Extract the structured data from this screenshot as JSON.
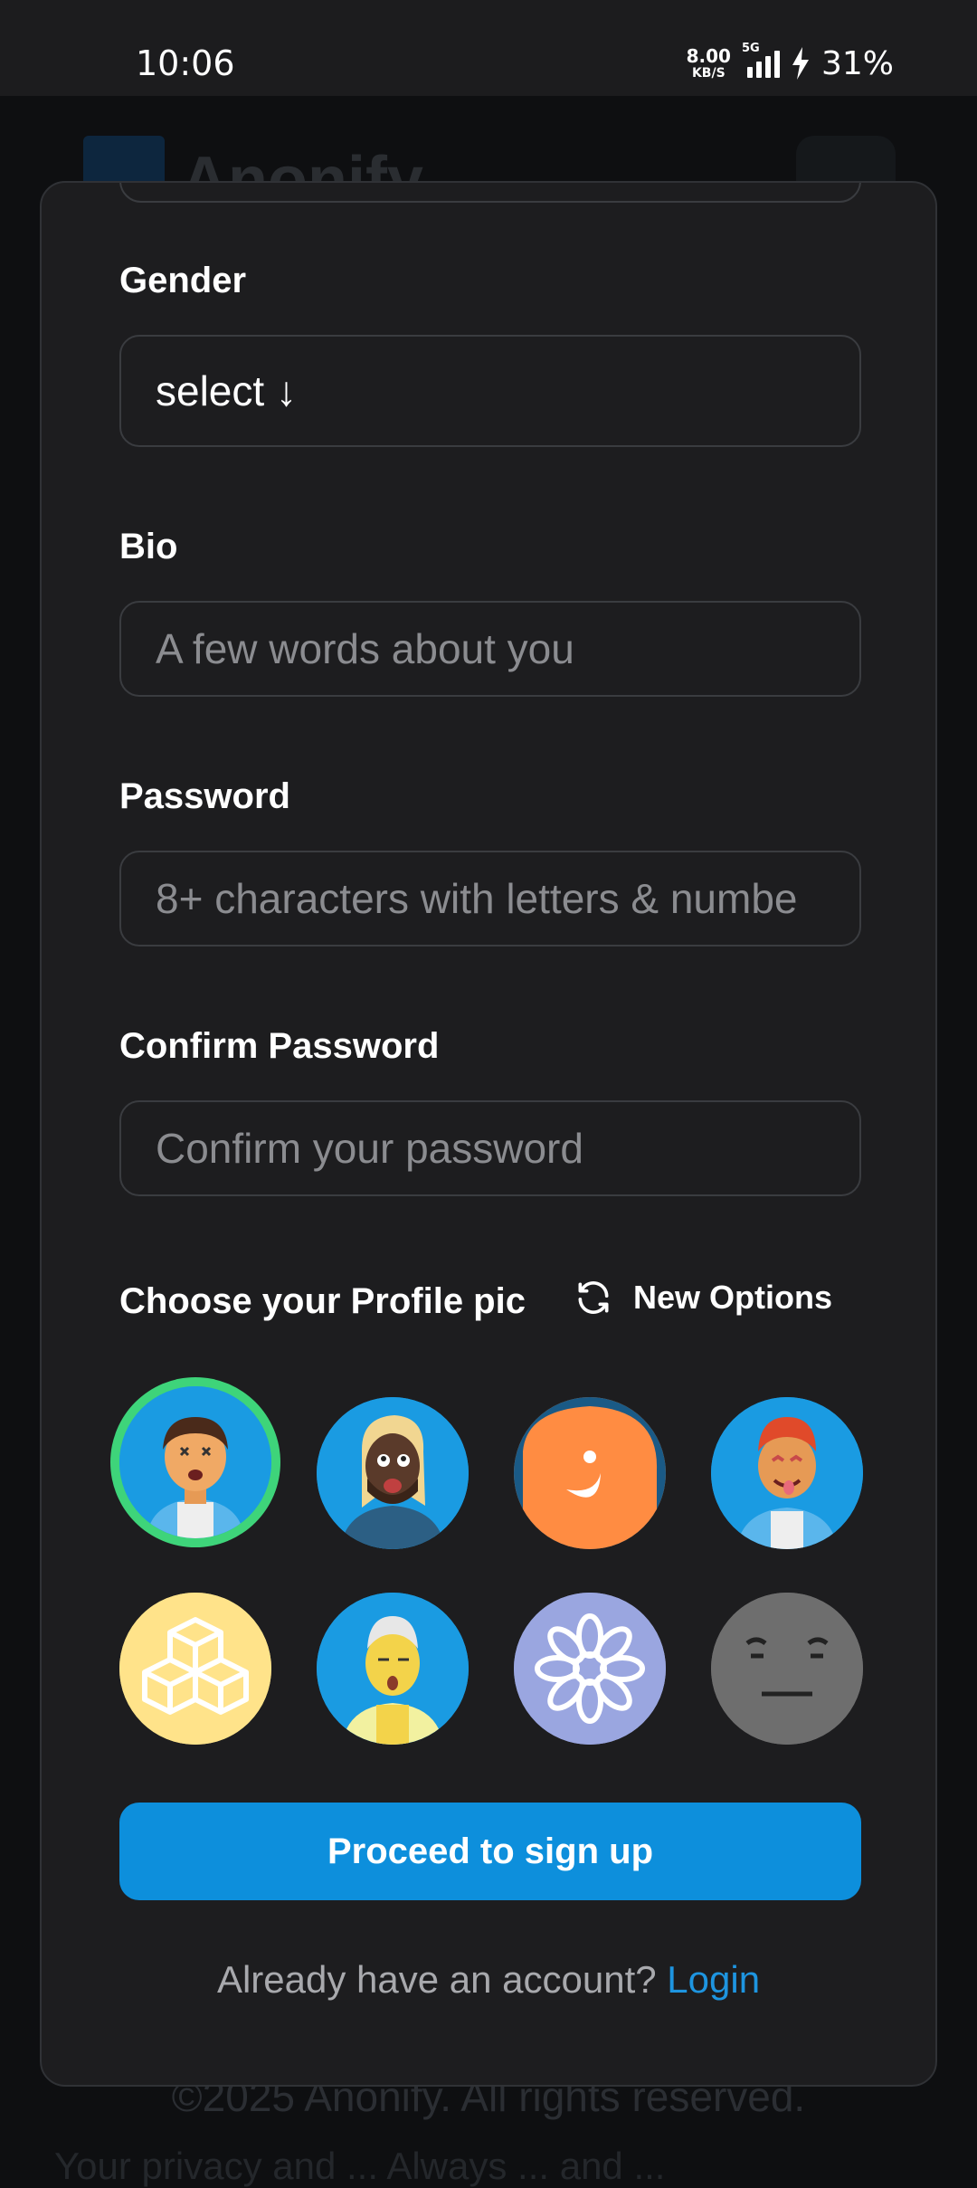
{
  "status_bar": {
    "time": "10:06",
    "net_speed_value": "8.00",
    "net_speed_unit": "KB/S",
    "network_type": "5G",
    "battery": "31%"
  },
  "background": {
    "brand": "Anonify",
    "footer": "©2025 Anonify. All rights reserved.",
    "footer_2": "Your privacy and ... Always ... and ..."
  },
  "form": {
    "gender": {
      "label": "Gender",
      "value": "select ↓"
    },
    "bio": {
      "label": "Bio",
      "placeholder": "A few words about you"
    },
    "password": {
      "label": "Password",
      "placeholder": "8+ characters with letters & numbe"
    },
    "confirm_password": {
      "label": "Confirm Password",
      "placeholder": "Confirm your password"
    },
    "profile_pic": {
      "label": "Choose your Profile pic",
      "new_options_label": "New Options",
      "selected_index": 0,
      "avatars": [
        {
          "name": "avatar-dizzy-man",
          "bg": "#1a9be2"
        },
        {
          "name": "avatar-blonde-man",
          "bg": "#1a9be2"
        },
        {
          "name": "avatar-orange-blob",
          "bg": "#ff8c42"
        },
        {
          "name": "avatar-redhead-man",
          "bg": "#1a9be2"
        },
        {
          "name": "avatar-cubes",
          "bg": "#ffe38a"
        },
        {
          "name": "avatar-yellow-man",
          "bg": "#1a9be2"
        },
        {
          "name": "avatar-flower",
          "bg": "#9aa6e0"
        },
        {
          "name": "avatar-grey-face",
          "bg": "#6e6e6e"
        }
      ]
    },
    "submit_label": "Proceed to sign up",
    "login_prompt": "Already have an account? ",
    "login_link": "Login"
  },
  "colors": {
    "card_bg": "#1d1d1f",
    "accent": "#0d8fdc",
    "link": "#1e95e0",
    "selected_ring": "#3ed47a"
  }
}
